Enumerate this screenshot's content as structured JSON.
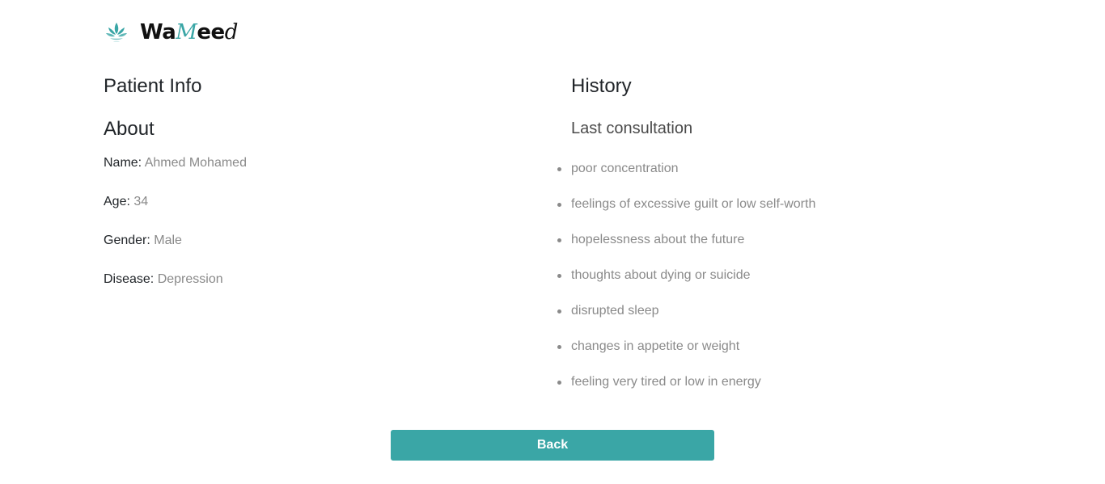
{
  "brand": {
    "logo_text_part1": "Wa",
    "logo_text_accent": "M",
    "logo_text_part2": "ee",
    "logo_text_tail": "d",
    "accent_color": "#3aa6a6"
  },
  "patient": {
    "heading": "Patient Info",
    "about_heading": "About",
    "fields": [
      {
        "label": "Name:",
        "value": "Ahmed Mohamed"
      },
      {
        "label": "Age:",
        "value": "34"
      },
      {
        "label": "Gender:",
        "value": "Male"
      },
      {
        "label": "Disease:",
        "value": "Depression"
      }
    ]
  },
  "history": {
    "heading": "History",
    "last_consultation_heading": "Last consultation",
    "symptoms": [
      "poor concentration",
      "feelings of excessive guilt or low self-worth",
      "hopelessness about the future",
      "thoughts about dying or suicide",
      "disrupted sleep",
      "changes in appetite or weight",
      "feeling very tired or low in energy"
    ]
  },
  "actions": {
    "back_label": "Back",
    "back_color": "#3aa6a6"
  }
}
